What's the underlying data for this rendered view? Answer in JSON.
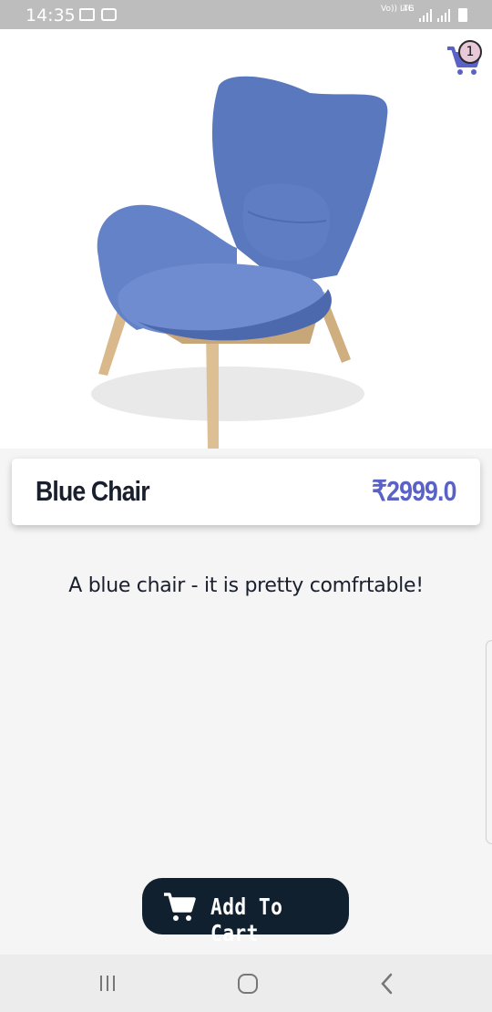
{
  "status_bar": {
    "time": "14:35",
    "network_volte": "Vo)) LTE",
    "network_4g": "4G",
    "icons": [
      "gallery-icon",
      "wifi-icon",
      "signal-icon",
      "signal-icon",
      "battery-icon"
    ]
  },
  "cart": {
    "count": "1",
    "icon": "cart-icon",
    "color": "#5b62c6"
  },
  "product": {
    "name": "Blue Chair",
    "price": "₹2999.0",
    "description": "A blue chair - it is pretty comfrtable!",
    "image": "blue-armchair-image"
  },
  "actions": {
    "add_to_cart_label": "Add To Cart",
    "add_to_cart_icon": "cart-icon"
  },
  "nav_bar": {
    "items": [
      "recent-apps-icon",
      "home-icon",
      "back-icon"
    ]
  },
  "colors": {
    "accent": "#5b62c6",
    "dark": "#10202f",
    "text": "#1a1f2e"
  }
}
